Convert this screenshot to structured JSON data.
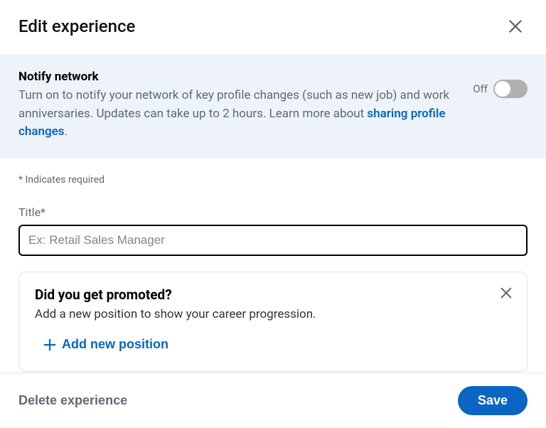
{
  "header": {
    "title": "Edit experience"
  },
  "notify": {
    "title": "Notify network",
    "desc_prefix": "Turn on to notify your network of key profile changes (such as new job) and work anniversaries. Updates can take up to 2 hours. Learn more about ",
    "link_text": "sharing profile changes",
    "desc_suffix": ".",
    "toggle_state_label": "Off"
  },
  "form": {
    "required_note": "* Indicates required",
    "title_label": "Title*",
    "title_placeholder": "Ex: Retail Sales Manager",
    "title_value": ""
  },
  "promo": {
    "title": "Did you get promoted?",
    "desc": "Add a new position to show your career progression.",
    "add_label": "Add new position"
  },
  "footer": {
    "delete_label": "Delete experience",
    "save_label": "Save"
  }
}
